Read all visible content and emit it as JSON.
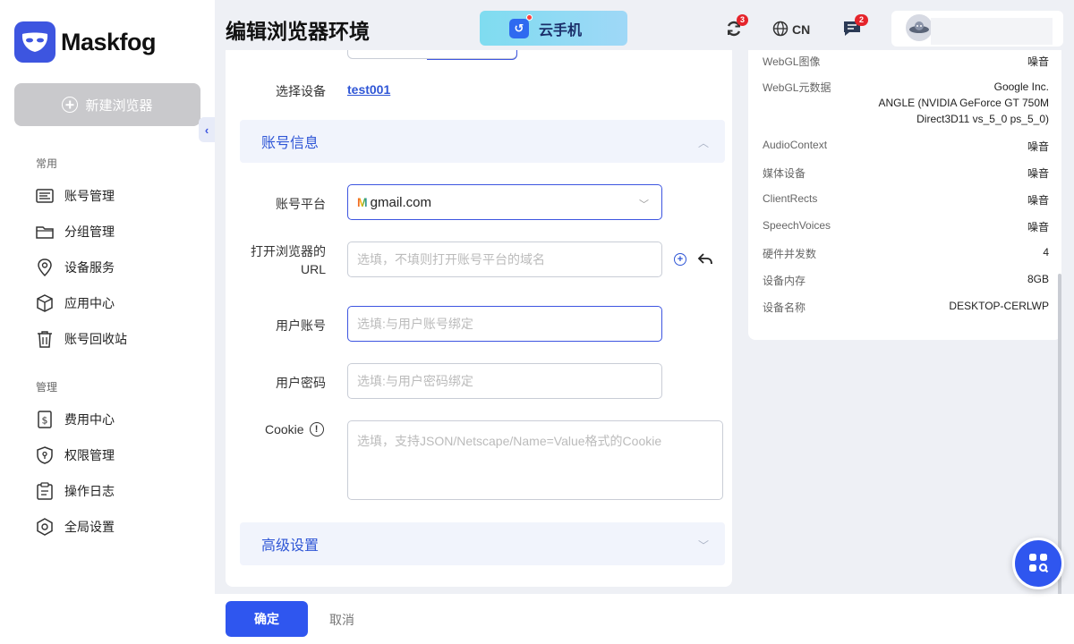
{
  "app": {
    "name": "Maskfog"
  },
  "sidebar": {
    "new_button": "新建浏览器",
    "section_common": "常用",
    "common_items": [
      {
        "label": "账号管理",
        "icon": "account-list-icon"
      },
      {
        "label": "分组管理",
        "icon": "folder-icon"
      },
      {
        "label": "设备服务",
        "icon": "location-pin-icon"
      },
      {
        "label": "应用中心",
        "icon": "cube-icon"
      },
      {
        "label": "账号回收站",
        "icon": "trash-icon"
      }
    ],
    "section_manage": "管理",
    "manage_items": [
      {
        "label": "费用中心",
        "icon": "dollar-icon"
      },
      {
        "label": "权限管理",
        "icon": "shield-icon"
      },
      {
        "label": "操作日志",
        "icon": "clipboard-icon"
      },
      {
        "label": "全局设置",
        "icon": "gear-icon"
      }
    ]
  },
  "header": {
    "title": "编辑浏览器环境",
    "cloud_phone": "云手机",
    "sync_badge": "3",
    "language": "CN",
    "message_badge": "2"
  },
  "form": {
    "device_label": "选择设备",
    "device_value": "test001",
    "account_section": "账号信息",
    "platform_label": "账号平台",
    "platform_value": "gmail.com",
    "url_label_line1": "打开浏览器的",
    "url_label_line2": "URL",
    "url_placeholder": "选填，不填则打开账号平台的域名",
    "user_label": "用户账号",
    "user_placeholder": "选填:与用户账号绑定",
    "password_label": "用户密码",
    "password_placeholder": "选填:与用户密码绑定",
    "cookie_label": "Cookie",
    "cookie_placeholder": "选填，支持JSON/Netscape/Name=Value格式的Cookie",
    "advanced_section": "高级设置"
  },
  "info": {
    "rows": [
      {
        "key": "WebGL图像",
        "value": "噪音"
      },
      {
        "key": "WebGL元数据",
        "value": "Google Inc."
      },
      {
        "key": "AudioContext",
        "value": "噪音"
      },
      {
        "key": "媒体设备",
        "value": "噪音"
      },
      {
        "key": "ClientRects",
        "value": "噪音"
      },
      {
        "key": "SpeechVoices",
        "value": "噪音"
      },
      {
        "key": "硬件并发数",
        "value": "4"
      },
      {
        "key": "设备内存",
        "value": "8GB"
      },
      {
        "key": "设备名称",
        "value": "DESKTOP-CERLWP"
      }
    ],
    "webgl_renderer_line1": "ANGLE (NVIDIA GeForce GT 750M",
    "webgl_renderer_line2": "Direct3D11 vs_5_0 ps_5_0)"
  },
  "footer": {
    "confirm": "确定",
    "cancel": "取消"
  },
  "colors": {
    "primary": "#2f56ef",
    "badge": "#e5242b",
    "section_bg": "#f1f4fc"
  }
}
